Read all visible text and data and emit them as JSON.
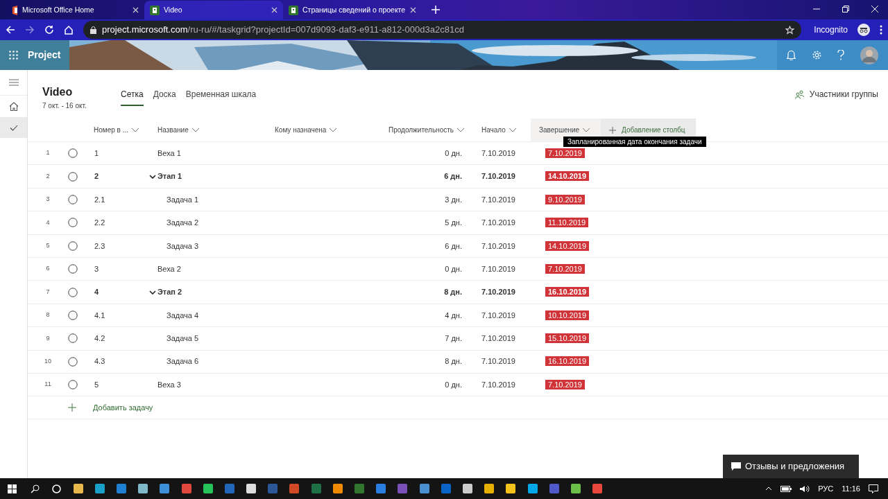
{
  "browser": {
    "tabs": [
      {
        "title": "Microsoft Office Home",
        "selected": false
      },
      {
        "title": "Video",
        "selected": true
      },
      {
        "title": "Страницы сведений о проекте",
        "selected": false
      }
    ],
    "url_host": "project.microsoft.com",
    "url_path": "/ru-ru/#/taskgrid?projectId=007d9093-daf3-e911-a812-000d3a2c81cd",
    "profile": "Incognito"
  },
  "app": {
    "name": "Project"
  },
  "project": {
    "title": "Video",
    "dates": "7 окт. - 16 окт."
  },
  "views": [
    {
      "label": "Сетка",
      "selected": true
    },
    {
      "label": "Доска",
      "selected": false
    },
    {
      "label": "Временная шкала",
      "selected": false
    }
  ],
  "group_members": "Участники группы",
  "columns": [
    "Номер в ...",
    "Название",
    "Кому назначена",
    "Продолжительность",
    "Начало",
    "Завершение"
  ],
  "add_column": "Добавление столбц",
  "tooltip": "Запланированная дата окончания задачи",
  "rows": [
    {
      "kind": "milestone",
      "number": "1",
      "id": "1",
      "name": "Веха 1",
      "duration": "0 дн.",
      "start": "7.10.2019",
      "finish": "7.10.2019"
    },
    {
      "kind": "summary",
      "number": "2",
      "id": "2",
      "name": "Этап 1",
      "duration": "6 дн.",
      "start": "7.10.2019",
      "finish": "14.10.2019",
      "expanded": true,
      "children": [
        {
          "kind": "task",
          "number": "3",
          "id": "2.1",
          "name": "Задача 1",
          "duration": "3 дн.",
          "start": "7.10.2019",
          "finish": "9.10.2019"
        },
        {
          "kind": "task",
          "number": "4",
          "id": "2.2",
          "name": "Задача 2",
          "duration": "5 дн.",
          "start": "7.10.2019",
          "finish": "11.10.2019"
        },
        {
          "kind": "task",
          "number": "5",
          "id": "2.3",
          "name": "Задача 3",
          "duration": "6 дн.",
          "start": "7.10.2019",
          "finish": "14.10.2019"
        }
      ]
    },
    {
      "kind": "milestone",
      "number": "6",
      "id": "3",
      "name": "Веха 2",
      "duration": "0 дн.",
      "start": "7.10.2019",
      "finish": "7.10.2019"
    },
    {
      "kind": "summary",
      "number": "7",
      "id": "4",
      "name": "Этап 2",
      "duration": "8 дн.",
      "start": "7.10.2019",
      "finish": "16.10.2019",
      "expanded": true,
      "children": [
        {
          "kind": "task",
          "number": "8",
          "id": "4.1",
          "name": "Задача 4",
          "duration": "4 дн.",
          "start": "7.10.2019",
          "finish": "10.10.2019"
        },
        {
          "kind": "task",
          "number": "9",
          "id": "4.2",
          "name": "Задача 5",
          "duration": "7 дн.",
          "start": "7.10.2019",
          "finish": "15.10.2019"
        },
        {
          "kind": "task",
          "number": "10",
          "id": "4.3",
          "name": "Задача 6",
          "duration": "8 дн.",
          "start": "7.10.2019",
          "finish": "16.10.2019"
        }
      ]
    },
    {
      "kind": "milestone",
      "number": "11",
      "id": "5",
      "name": "Веха 3",
      "duration": "0 дн.",
      "start": "7.10.2019",
      "finish": "7.10.2019"
    }
  ],
  "add_task": "Добавить задачу",
  "feedback": "Отзывы и предложения",
  "taskbar": {
    "language": "РУС",
    "time": "11:16"
  }
}
